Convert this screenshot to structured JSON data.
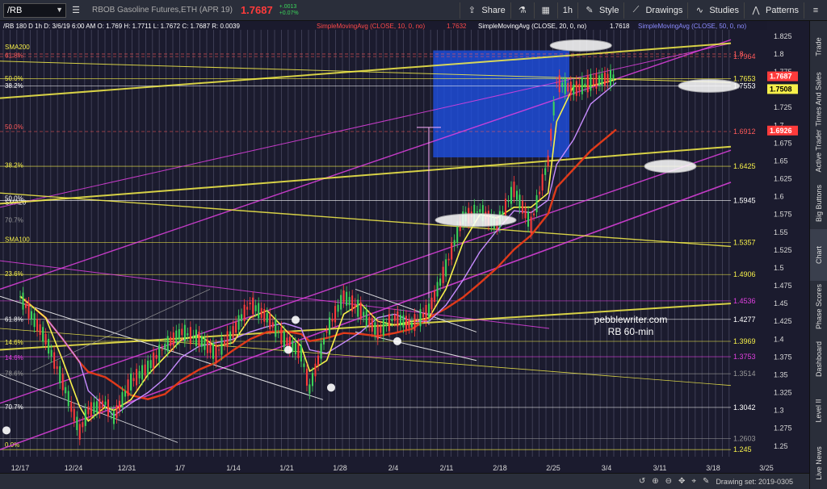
{
  "toolbar": {
    "symbol": "/RB",
    "instrument_name": "RBOB Gasoline Futures,ETH (APR 19)",
    "last_price": "1.7687",
    "change_abs": "+.0013",
    "change_pct": "+0.07%",
    "share_label": "Share",
    "interval_label": "1h",
    "style_label": "Style",
    "drawings_label": "Drawings",
    "studies_label": "Studies",
    "patterns_label": "Patterns"
  },
  "right_tabs": [
    "Trade",
    "Times And Sales",
    "Active Trader",
    "Big Buttons",
    "Chart",
    "Phase Scores",
    "Dashboard",
    "Level II",
    "Live News"
  ],
  "active_tab": "Chart",
  "bottom": {
    "drawing_set": "Drawing set: 2019-0305"
  },
  "watermark": {
    "line1": "pebblewriter.com",
    "line2": "RB 60-min"
  },
  "colors": {
    "bg": "#1b1b2e",
    "accent_red": "#ff3b3b",
    "accent_yellow": "#e8e33a",
    "accent_magenta": "#e040e0",
    "up_green": "#3bd65a",
    "sma10": "#f7f04a",
    "sma20": "#c78cff",
    "sma50": "#e03a1a"
  },
  "chart_data": {
    "type": "line",
    "header": {
      "info": "/RB 180 D 1h   D: 3/6/19 6:00 AM   O: 1.769   H: 1.7711   L: 1.7672   C: 1.7687   R: 0.0039",
      "sma10_label": "SimpleMovingAvg (CLOSE, 10, 0, no)",
      "sma10_value": "1.7632",
      "sma20_label": "SimpleMovingAvg (CLOSE, 20, 0, no)",
      "sma20_value": "1.7618",
      "sma50_label": "SimpleMovingAvg (CLOSE, 50, 0, no)"
    },
    "x_ticks": [
      "12/17",
      "12/24",
      "12/31",
      "1/7",
      "1/14",
      "1/21",
      "1/28",
      "2/4",
      "2/11",
      "2/18",
      "2/25",
      "3/4",
      "3/11",
      "3/18",
      "3/25"
    ],
    "y_ticks": [
      "1.825",
      "1.8",
      "1.775",
      "1.75",
      "1.725",
      "1.7",
      "1.675",
      "1.65",
      "1.625",
      "1.6",
      "1.575",
      "1.55",
      "1.525",
      "1.5",
      "1.475",
      "1.45",
      "1.425",
      "1.4",
      "1.375",
      "1.35",
      "1.325",
      "1.3",
      "1.275",
      "1.25"
    ],
    "ylim": [
      1.235,
      1.835
    ],
    "price_path": [
      {
        "x": 0,
        "y": 1.46
      },
      {
        "x": 3,
        "y": 1.4
      },
      {
        "x": 5,
        "y": 1.34
      },
      {
        "x": 7,
        "y": 1.27
      },
      {
        "x": 8,
        "y": 1.3
      },
      {
        "x": 10,
        "y": 1.31
      },
      {
        "x": 11,
        "y": 1.29
      },
      {
        "x": 13,
        "y": 1.34
      },
      {
        "x": 15,
        "y": 1.36
      },
      {
        "x": 17,
        "y": 1.39
      },
      {
        "x": 19,
        "y": 1.41
      },
      {
        "x": 21,
        "y": 1.4
      },
      {
        "x": 23,
        "y": 1.38
      },
      {
        "x": 25,
        "y": 1.41
      },
      {
        "x": 27,
        "y": 1.45
      },
      {
        "x": 29,
        "y": 1.43
      },
      {
        "x": 31,
        "y": 1.4
      },
      {
        "x": 33,
        "y": 1.38
      },
      {
        "x": 34,
        "y": 1.33
      },
      {
        "x": 36,
        "y": 1.41
      },
      {
        "x": 38,
        "y": 1.46
      },
      {
        "x": 40,
        "y": 1.44
      },
      {
        "x": 42,
        "y": 1.41
      },
      {
        "x": 44,
        "y": 1.43
      },
      {
        "x": 46,
        "y": 1.42
      },
      {
        "x": 48,
        "y": 1.44
      },
      {
        "x": 50,
        "y": 1.5
      },
      {
        "x": 52,
        "y": 1.57
      },
      {
        "x": 54,
        "y": 1.58
      },
      {
        "x": 56,
        "y": 1.56
      },
      {
        "x": 58,
        "y": 1.61
      },
      {
        "x": 60,
        "y": 1.56
      },
      {
        "x": 62,
        "y": 1.65
      },
      {
        "x": 63,
        "y": 1.76
      },
      {
        "x": 65,
        "y": 1.75
      },
      {
        "x": 67,
        "y": 1.76
      },
      {
        "x": 70,
        "y": 1.7687
      }
    ],
    "right_labels": [
      {
        "text": "1.8",
        "y": 1.8,
        "color": "#ff5a5a"
      },
      {
        "text": "1.7964",
        "y": 1.7964,
        "color": "#ff5a5a"
      },
      {
        "text": "1.7653",
        "y": 1.7653,
        "color": "#f7f04a"
      },
      {
        "text": "1.7553",
        "y": 1.7553,
        "color": "#ffffff"
      },
      {
        "text": "1.6912",
        "y": 1.6912,
        "color": "#ff5a5a"
      },
      {
        "text": "1.6425",
        "y": 1.6425,
        "color": "#f7f04a"
      },
      {
        "text": "1.5945",
        "y": 1.5945,
        "color": "#ffffff"
      },
      {
        "text": "1.5357",
        "y": 1.5357,
        "color": "#f7f04a"
      },
      {
        "text": "1.4906",
        "y": 1.4906,
        "color": "#f7f04a"
      },
      {
        "text": "1.4536",
        "y": 1.4536,
        "color": "#e040e0"
      },
      {
        "text": "1.4277",
        "y": 1.4277,
        "color": "#ffffff"
      },
      {
        "text": "1.3969",
        "y": 1.3969,
        "color": "#f7f04a"
      },
      {
        "text": "1.3753",
        "y": 1.3753,
        "color": "#e040e0"
      },
      {
        "text": "1.3514",
        "y": 1.3514,
        "color": "#999999"
      },
      {
        "text": "1.3042",
        "y": 1.3042,
        "color": "#ffffff"
      },
      {
        "text": "1.2603",
        "y": 1.2603,
        "color": "#999999"
      },
      {
        "text": "1.245",
        "y": 1.245,
        "color": "#f7f04a"
      }
    ],
    "price_tags": [
      {
        "text": "1.7687",
        "y": 1.7687,
        "bg": "#ff3b3b",
        "fg": "#ffffff"
      },
      {
        "text": "1.7508",
        "y": 1.7508,
        "bg": "#f7f04a",
        "fg": "#000000"
      },
      {
        "text": "1.6926",
        "y": 1.6926,
        "bg": "#ff3b3b",
        "fg": "#ffffff"
      }
    ],
    "left_labels": [
      {
        "text": "SMA200",
        "y": 1.81,
        "color": "#f7f04a"
      },
      {
        "text": "61.8%",
        "y": 1.798,
        "color": "#ff5a5a"
      },
      {
        "text": "50.0%",
        "y": 1.766,
        "color": "#f7f04a"
      },
      {
        "text": "38.2%",
        "y": 1.756,
        "color": "#ffffff"
      },
      {
        "text": "50.0%",
        "y": 1.698,
        "color": "#ff5a5a"
      },
      {
        "text": "38.2%",
        "y": 1.644,
        "color": "#f7f04a"
      },
      {
        "text": "50.0%",
        "y": 1.598,
        "color": "#ffffff"
      },
      {
        "text": "SMA20",
        "y": 1.592,
        "color": "#ffffff"
      },
      {
        "text": "70.7%",
        "y": 1.567,
        "color": "#999999"
      },
      {
        "text": "SMA100",
        "y": 1.54,
        "color": "#f7f04a"
      },
      {
        "text": "23.6%",
        "y": 1.492,
        "color": "#f7f04a"
      },
      {
        "text": "61.8%",
        "y": 1.428,
        "color": "#ffffff"
      },
      {
        "text": "14.6%",
        "y": 1.396,
        "color": "#f7f04a"
      },
      {
        "text": "14.6%",
        "y": 1.374,
        "color": "#e040e0"
      },
      {
        "text": "78.6%",
        "y": 1.352,
        "color": "#999999"
      },
      {
        "text": "70.7%",
        "y": 1.305,
        "color": "#ffffff"
      },
      {
        "text": "0.0%",
        "y": 1.252,
        "color": "#f7f04a"
      }
    ]
  }
}
